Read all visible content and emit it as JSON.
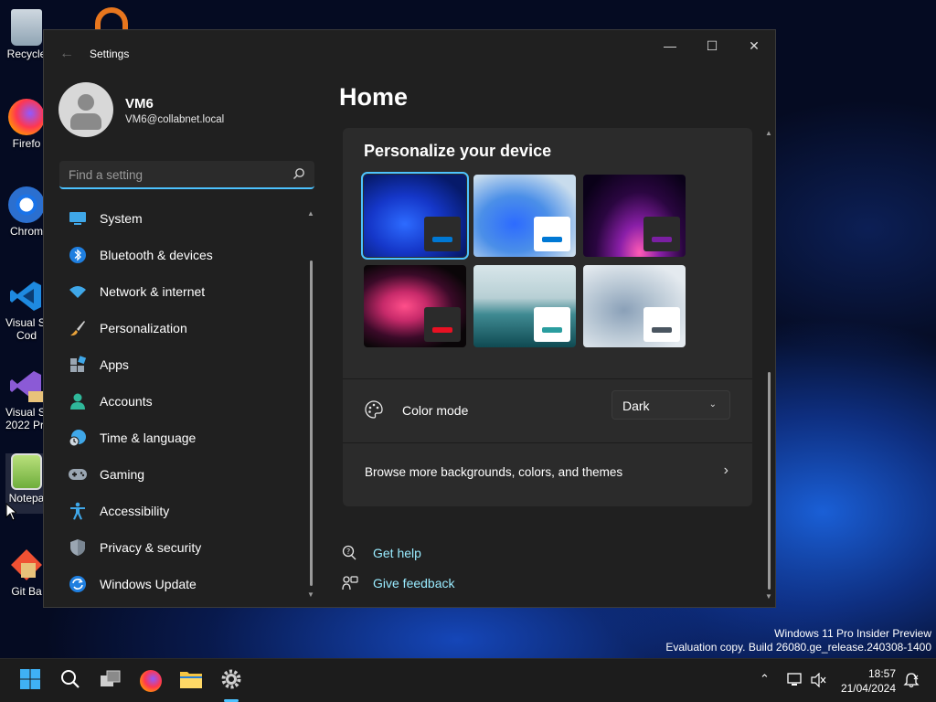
{
  "desktop": {
    "icons": [
      {
        "label": "Recycle"
      },
      {
        "label": "Firefo"
      },
      {
        "label": "Chrom"
      },
      {
        "label": "Visual St",
        "label2": "Cod"
      },
      {
        "label": "Visual St",
        "label2": "2022 Pre"
      },
      {
        "label": "Notepa"
      },
      {
        "label": "Git Ba"
      }
    ]
  },
  "window": {
    "title": "Settings",
    "controls": {
      "minimize": "—",
      "maximize": "☐",
      "close": "✕"
    }
  },
  "profile": {
    "name": "VM6",
    "email": "VM6@collabnet.local"
  },
  "search": {
    "placeholder": "Find a setting"
  },
  "nav": {
    "items": [
      {
        "label": "System",
        "icon": "monitor-icon"
      },
      {
        "label": "Bluetooth & devices",
        "icon": "bluetooth-icon"
      },
      {
        "label": "Network & internet",
        "icon": "wifi-icon"
      },
      {
        "label": "Personalization",
        "icon": "brush-icon"
      },
      {
        "label": "Apps",
        "icon": "apps-icon"
      },
      {
        "label": "Accounts",
        "icon": "person-icon"
      },
      {
        "label": "Time & language",
        "icon": "globe-clock-icon"
      },
      {
        "label": "Gaming",
        "icon": "gamepad-icon"
      },
      {
        "label": "Accessibility",
        "icon": "accessibility-icon"
      },
      {
        "label": "Privacy & security",
        "icon": "shield-icon"
      },
      {
        "label": "Windows Update",
        "icon": "update-icon"
      }
    ]
  },
  "main": {
    "page_title": "Home",
    "personalize": {
      "title": "Personalize your device",
      "themes": [
        {
          "name": "theme-1",
          "chip_bg": "#2b2b2b",
          "accent": "#0078d4",
          "selected": true
        },
        {
          "name": "theme-2",
          "chip_bg": "#ffffff",
          "accent": "#0078d4",
          "selected": false
        },
        {
          "name": "theme-3",
          "chip_bg": "#2b2b2b",
          "accent": "#7a1fa2",
          "selected": false
        },
        {
          "name": "theme-4",
          "chip_bg": "#2b2b2b",
          "accent": "#e81123",
          "selected": false
        },
        {
          "name": "theme-5",
          "chip_bg": "#ffffff",
          "accent": "#2a9d9f",
          "selected": false
        },
        {
          "name": "theme-6",
          "chip_bg": "#ffffff",
          "accent": "#4a5560",
          "selected": false
        }
      ],
      "color_mode": {
        "label": "Color mode",
        "value": "Dark"
      },
      "browse": {
        "label": "Browse more backgrounds, colors, and themes"
      }
    },
    "help": {
      "get_help": "Get help",
      "give_feedback": "Give feedback"
    }
  },
  "watermark": {
    "line1": "Windows 11 Pro Insider Preview",
    "line2": "Evaluation copy. Build 26080.ge_release.240308-1400"
  },
  "taskbar": {
    "time": "18:57",
    "date": "21/04/2024"
  },
  "colors": {
    "accent": "#4cc2ff",
    "link": "#99ebff",
    "window_bg": "#202020",
    "card_bg": "#2b2b2b"
  }
}
